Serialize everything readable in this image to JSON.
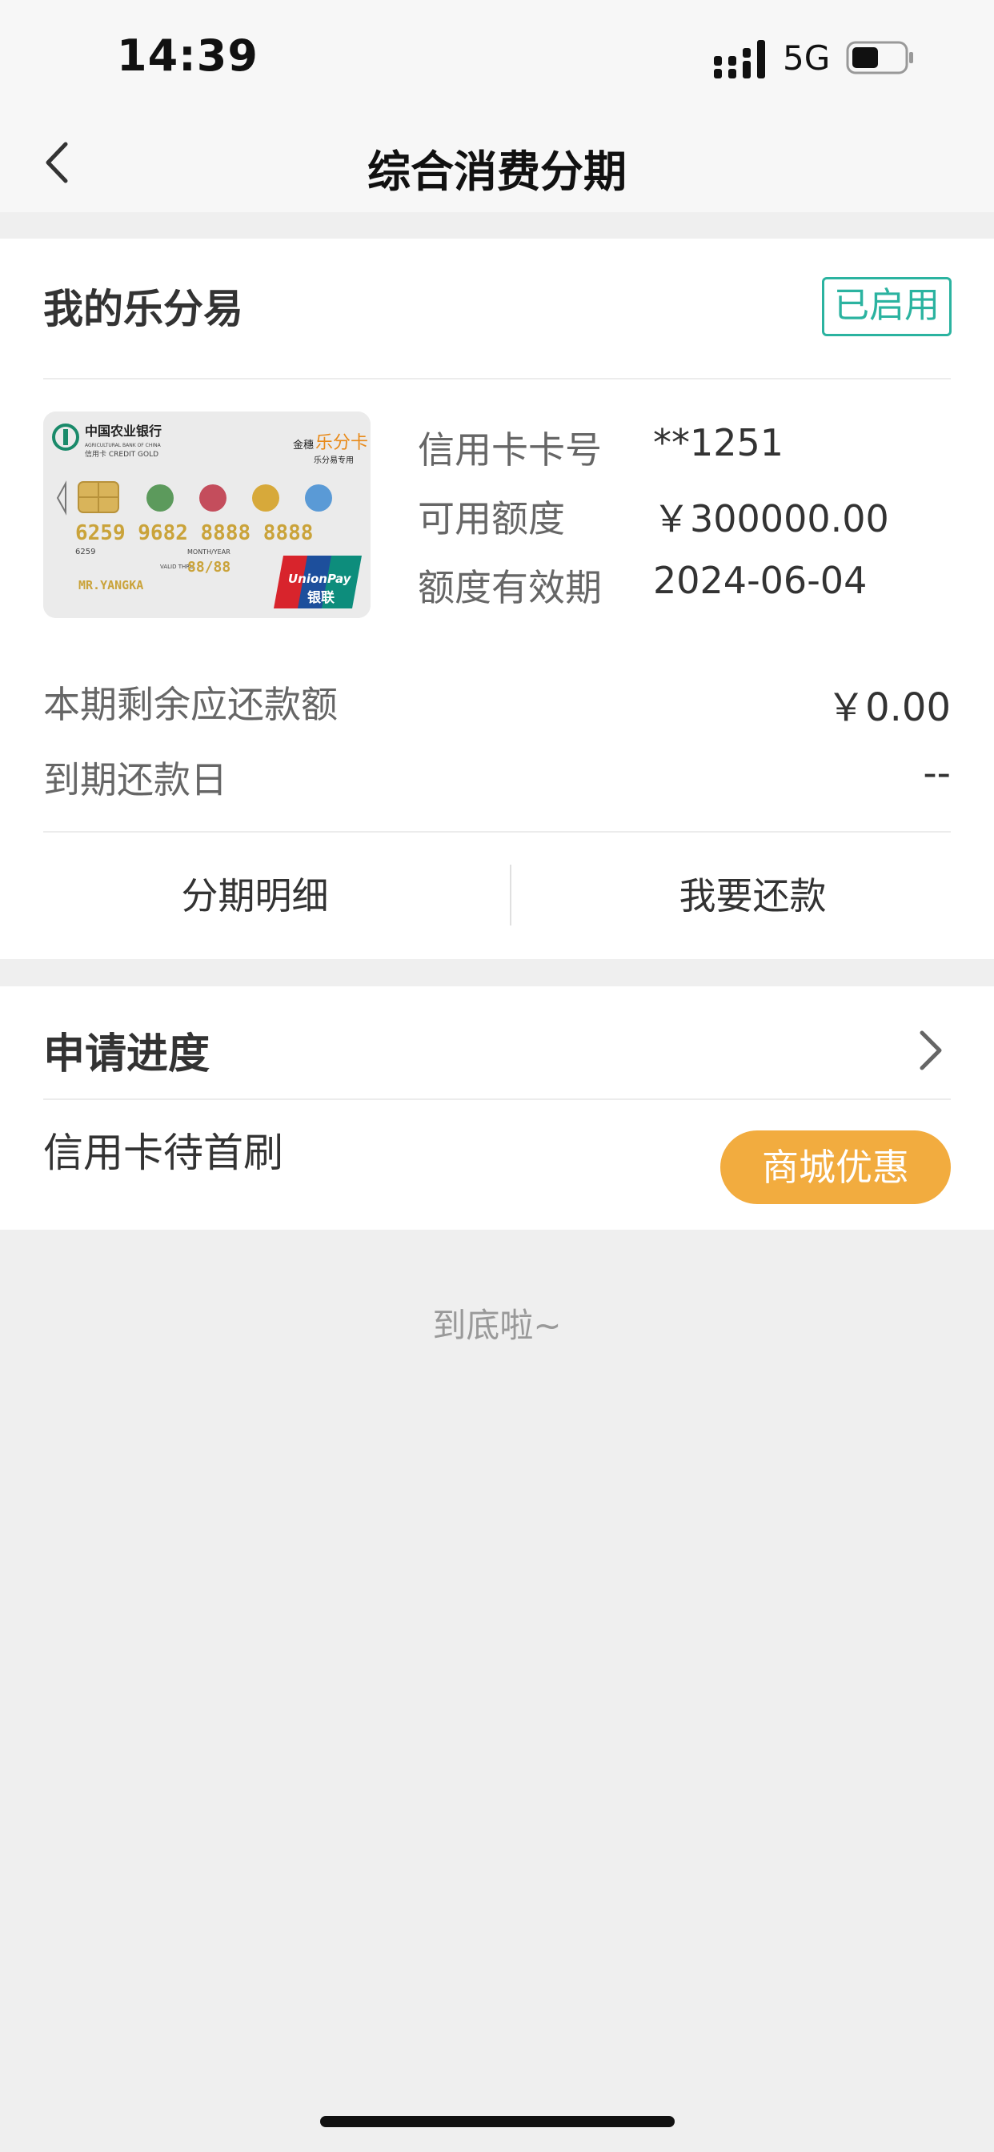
{
  "status_bar": {
    "time": "14:39",
    "network": "5G"
  },
  "nav": {
    "title": "综合消费分期",
    "back_icon": "chevron-left-icon"
  },
  "card_section": {
    "title": "我的乐分易",
    "status_badge": "已启用",
    "card_image": {
      "bank_name": "中国农业银行",
      "bank_name_en": "AGRICULTURAL BANK OF CHINA",
      "card_line": "信用卡 CREDIT GOLD",
      "brand": "乐分卡",
      "brand_prefix": "金穗",
      "brand_sub": "乐分易专用",
      "card_number": "6259 9682 8888 8888",
      "card_bin": "6259",
      "month_year_label": "MONTH/YEAR",
      "valid_label": "VALID THRU",
      "valid_value": "88/88",
      "holder": "MR.YANGKA",
      "network_logo": "UnionPay",
      "network_logo_cn": "银联"
    },
    "info": [
      {
        "label": "信用卡卡号",
        "value": "**1251"
      },
      {
        "label": "可用额度",
        "value": "￥300000.00"
      },
      {
        "label": "额度有效期",
        "value": "2024-06-04"
      }
    ],
    "repay_rows": [
      {
        "label": "本期剩余应还款额",
        "value": "￥0.00"
      },
      {
        "label": "到期还款日",
        "value": "--"
      }
    ],
    "actions": {
      "detail": "分期明细",
      "repay": "我要还款"
    }
  },
  "progress_section": {
    "title": "申请进度",
    "status": "信用卡待首刷",
    "mall_button": "商城优惠",
    "chevron_icon": "chevron-right-icon"
  },
  "footer": {
    "end_text": "到底啦~"
  },
  "colors": {
    "accent_teal": "#2bb3a0",
    "mall_orange": "#f2ac3f",
    "page_bg": "#efefef"
  }
}
